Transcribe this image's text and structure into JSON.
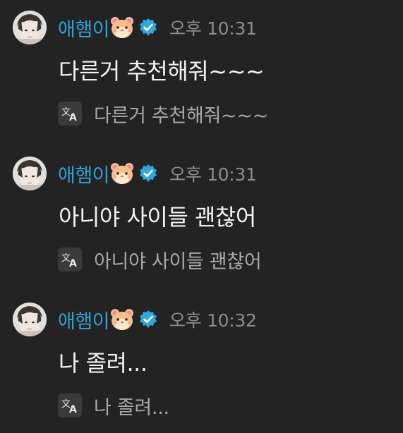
{
  "messages": [
    {
      "author": "애햄이",
      "author_emoji": "hamster-face-icon",
      "verified": true,
      "time": "오후 10:31",
      "text": "다른거 추천해줘~~~",
      "translation": "다른거 추천해줘~~~"
    },
    {
      "author": "애햄이",
      "author_emoji": "hamster-face-icon",
      "verified": true,
      "time": "오후 10:31",
      "text": "아니야 사이들 괜찮어",
      "translation": "아니야 사이들 괜찮어"
    },
    {
      "author": "애햄이",
      "author_emoji": "hamster-face-icon",
      "verified": true,
      "time": "오후 10:32",
      "text": "나 졸려...",
      "translation": "나 졸려..."
    }
  ],
  "colors": {
    "background": "#232323",
    "author_name": "#2fa3d9",
    "verified_badge": "#2ea8dd",
    "timestamp": "#8c8c8c",
    "message_text": "#f2f2f2",
    "translation_text": "#a9a9a9"
  }
}
